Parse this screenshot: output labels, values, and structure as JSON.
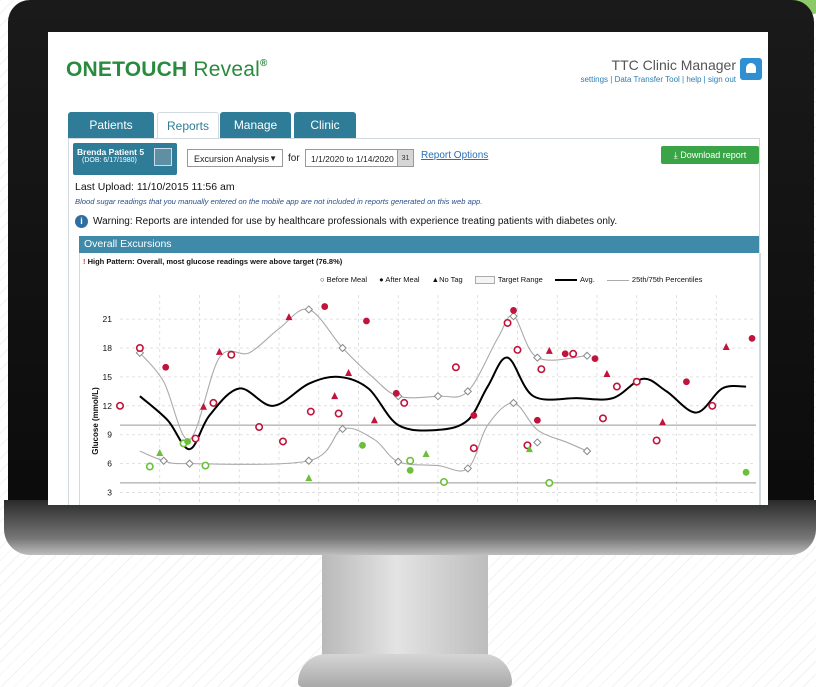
{
  "app": {
    "brand_one": "ONETOUCH",
    "brand_reveal": " Reveal",
    "brand_tm": "®"
  },
  "account": {
    "name": "TTC Clinic Manager",
    "links": "settings | Data Transfer Tool | help | sign out"
  },
  "tabs": [
    {
      "label": "Patients"
    },
    {
      "label": "Reports"
    },
    {
      "label": "Manage Clinic"
    },
    {
      "label": "Clinic Users"
    }
  ],
  "patient": {
    "name": "Brenda Patient 5",
    "dob": "(DOB: 6/17/1980)"
  },
  "report_select": {
    "value": "Excursion Analysis"
  },
  "for_label": "for",
  "date_range": "1/1/2020 to 1/14/2020",
  "calendar_day": "31",
  "report_options": "Report Options",
  "download_button": "Download report",
  "last_upload": "Last Upload: 11/10/2015 11:56 am",
  "disclaimer": "Blood sugar readings that you manually entered on the mobile app are not included in reports generated on this web app.",
  "warning": "Warning: Reports are intended for use by healthcare professionals with experience treating patients with diabetes only.",
  "section_title": "Overall Excursions",
  "pattern_bang": "!",
  "pattern_message": "High Pattern: Overall, most glucose readings were above target (76.8%)",
  "legend": {
    "before_meal": "Before Meal",
    "after_meal": "After Meal",
    "no_tag": "No Tag",
    "target_range": "Target Range",
    "avg": "Avg.",
    "percentiles": "25th/75th Percentiles"
  },
  "colors": {
    "after_meal": "#c0143c",
    "before_meal": "#c0143c",
    "no_tag": "#c0143c",
    "green": "#6cbf3a",
    "avg_line": "#000000",
    "percentile_line": "#aaaaaa",
    "accent": "#2e7c97"
  },
  "chart_data": {
    "type": "scatter",
    "ylabel": "Glucose (mmol/L)",
    "yticks": [
      3,
      6,
      9,
      12,
      15,
      18,
      21
    ],
    "ylim": [
      1.5,
      23.5
    ],
    "xlim": [
      0,
      24
    ],
    "target_range": [
      4,
      10
    ],
    "avg_line": [
      [
        1,
        13
      ],
      [
        2.4,
        10.5
      ],
      [
        3.5,
        7.5
      ],
      [
        4.5,
        11
      ],
      [
        6,
        13.8
      ],
      [
        7.7,
        12
      ],
      [
        9.5,
        14.3
      ],
      [
        11,
        15
      ],
      [
        12.5,
        13.8
      ],
      [
        14,
        10
      ],
      [
        16,
        9.5
      ],
      [
        17.5,
        10.5
      ],
      [
        18.5,
        14
      ],
      [
        19.5,
        17
      ],
      [
        20.8,
        13
      ],
      [
        23,
        12.8
      ],
      [
        24.8,
        12.8
      ],
      [
        26.3,
        14.8
      ],
      [
        27.5,
        13.5
      ],
      [
        29,
        11.3
      ],
      [
        30.3,
        13.8
      ],
      [
        31.5,
        14
      ]
    ],
    "p75_line": [
      [
        1,
        17.5
      ],
      [
        2.2,
        14.5
      ],
      [
        3.5,
        8.5
      ],
      [
        5,
        17
      ],
      [
        6.5,
        17.5
      ],
      [
        8,
        20
      ],
      [
        9.5,
        22
      ],
      [
        11.2,
        18
      ],
      [
        12.7,
        15
      ],
      [
        14,
        13
      ],
      [
        16,
        13
      ],
      [
        17.5,
        13.5
      ],
      [
        19,
        19
      ],
      [
        19.8,
        21.3
      ],
      [
        21,
        17
      ],
      [
        23.5,
        17.2
      ]
    ],
    "p25_line": [
      [
        1,
        7.3
      ],
      [
        2.2,
        6.3
      ],
      [
        3.5,
        6
      ],
      [
        9.5,
        6.3
      ],
      [
        11.2,
        9.6
      ],
      [
        12.8,
        8.5
      ],
      [
        14,
        6.2
      ],
      [
        16,
        5.8
      ],
      [
        17.5,
        5.5
      ],
      [
        18.5,
        10
      ],
      [
        19.8,
        12.3
      ],
      [
        21,
        9.5
      ],
      [
        22.5,
        8.2
      ],
      [
        23.5,
        7.3
      ]
    ],
    "before_meal": [
      [
        1,
        17.5
      ],
      [
        2.2,
        6.3
      ],
      [
        3.5,
        6
      ],
      [
        9.5,
        22
      ],
      [
        11.2,
        18
      ],
      [
        14,
        13
      ],
      [
        16,
        13
      ],
      [
        17.5,
        13.5
      ],
      [
        19.8,
        21.3
      ],
      [
        21,
        17
      ],
      [
        23.5,
        17.2
      ],
      [
        9.5,
        6.3
      ],
      [
        11.2,
        9.6
      ],
      [
        14,
        6.2
      ],
      [
        17.5,
        5.5
      ],
      [
        19.8,
        12.3
      ],
      [
        21,
        8.2
      ],
      [
        23.5,
        7.3
      ]
    ],
    "after_meal_filled": [
      [
        2.3,
        16
      ],
      [
        10.3,
        22.3
      ],
      [
        12.4,
        20.8
      ],
      [
        13.9,
        13.3
      ],
      [
        17.8,
        11
      ],
      [
        19.8,
        21.9
      ],
      [
        21,
        10.5
      ],
      [
        22.4,
        17.4
      ],
      [
        23.9,
        16.9
      ],
      [
        28.5,
        14.5
      ],
      [
        31.8,
        19
      ]
    ],
    "after_meal_open": [
      [
        0,
        12
      ],
      [
        1,
        18
      ],
      [
        3.8,
        8.6
      ],
      [
        4.7,
        12.3
      ],
      [
        5.6,
        17.3
      ],
      [
        7,
        9.8
      ],
      [
        8.2,
        8.3
      ],
      [
        9.6,
        11.4
      ],
      [
        11,
        11.2
      ],
      [
        14.3,
        12.3
      ],
      [
        16.9,
        16
      ],
      [
        17.8,
        7.6
      ],
      [
        19.5,
        20.6
      ],
      [
        20,
        17.8
      ],
      [
        20.5,
        7.9
      ],
      [
        21.2,
        15.8
      ],
      [
        22.8,
        17.4
      ],
      [
        24.3,
        10.7
      ],
      [
        25,
        14
      ],
      [
        26,
        14.5
      ],
      [
        27,
        8.4
      ],
      [
        29.8,
        12
      ]
    ],
    "no_tag": [
      [
        5,
        17.6
      ],
      [
        8.5,
        21.2
      ],
      [
        10.8,
        13
      ],
      [
        11.5,
        15.4
      ],
      [
        12.8,
        10.5
      ],
      [
        21.6,
        17.7
      ],
      [
        24.5,
        15.3
      ],
      [
        27.3,
        10.3
      ],
      [
        30.5,
        18.1
      ],
      [
        4.2,
        11.9
      ]
    ],
    "green_open": [
      [
        1.5,
        5.7
      ],
      [
        3.2,
        8.1
      ],
      [
        4.3,
        5.8
      ],
      [
        14.6,
        6.3
      ],
      [
        16.3,
        4.1
      ],
      [
        21.6,
        4
      ]
    ],
    "green_filled": [
      [
        3.4,
        8.3
      ],
      [
        12.2,
        7.9
      ],
      [
        14.6,
        5.3
      ],
      [
        31.5,
        5.1
      ]
    ],
    "green_triangle": [
      [
        2,
        7.1
      ],
      [
        9.5,
        4.5
      ],
      [
        15.4,
        7
      ],
      [
        20.6,
        7.5
      ]
    ]
  }
}
